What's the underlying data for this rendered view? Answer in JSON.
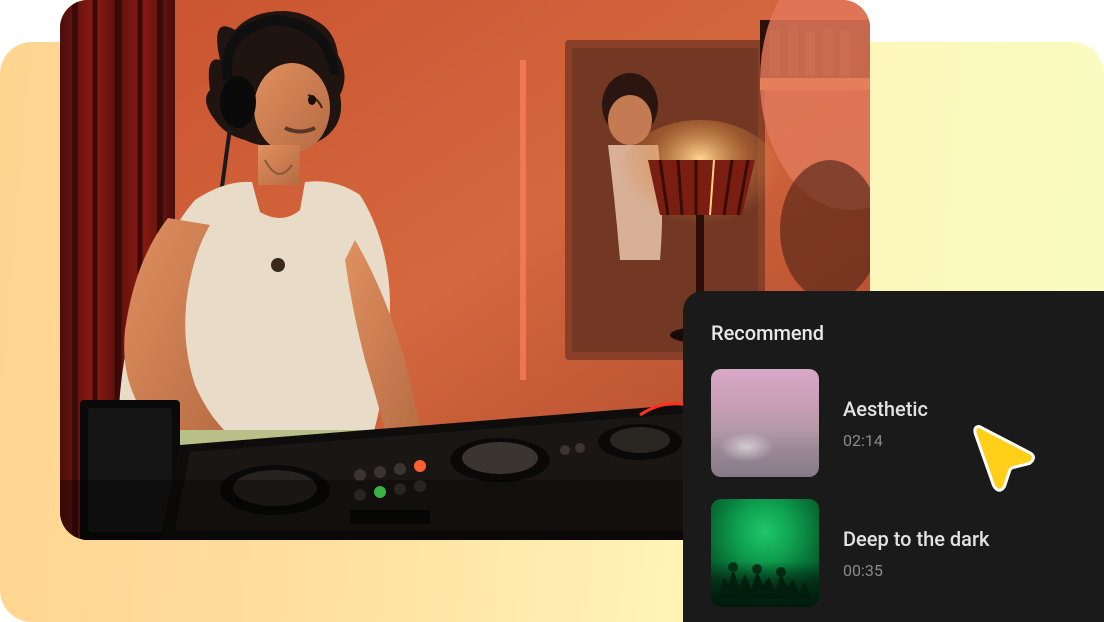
{
  "recommend": {
    "title": "Recommend",
    "tracks": [
      {
        "title": "Aesthetic",
        "duration": "02:14",
        "thumb": "aesthetic"
      },
      {
        "title": "Deep to the dark",
        "duration": "00:35",
        "thumb": "deep"
      }
    ]
  }
}
